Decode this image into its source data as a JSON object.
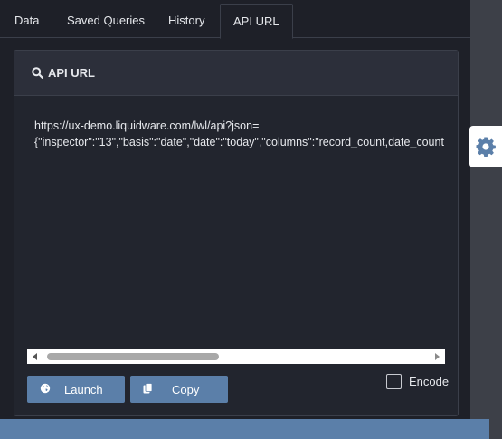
{
  "tabs": [
    {
      "label": "Data"
    },
    {
      "label": "Saved Queries"
    },
    {
      "label": "History"
    },
    {
      "label": "API URL",
      "active": true
    }
  ],
  "panel": {
    "title": "API URL",
    "title_icon": "search-icon",
    "url_line1": "https://ux-demo.liquidware.com/lwl/api?json=",
    "url_line2": "{\"inspector\":\"13\",\"basis\":\"date\",\"date\":\"today\",\"columns\":\"record_count,date_count"
  },
  "buttons": {
    "launch_label": "Launch",
    "launch_icon": "globe-icon",
    "copy_label": "Copy",
    "copy_icon": "copy-icon"
  },
  "encode": {
    "label": "Encode",
    "checked": false
  },
  "colors": {
    "background": "#1e2028",
    "panel": "#22252e",
    "panel_header": "#2c2f3a",
    "button": "#5b7fa9",
    "gear": "#5b7fa9"
  }
}
